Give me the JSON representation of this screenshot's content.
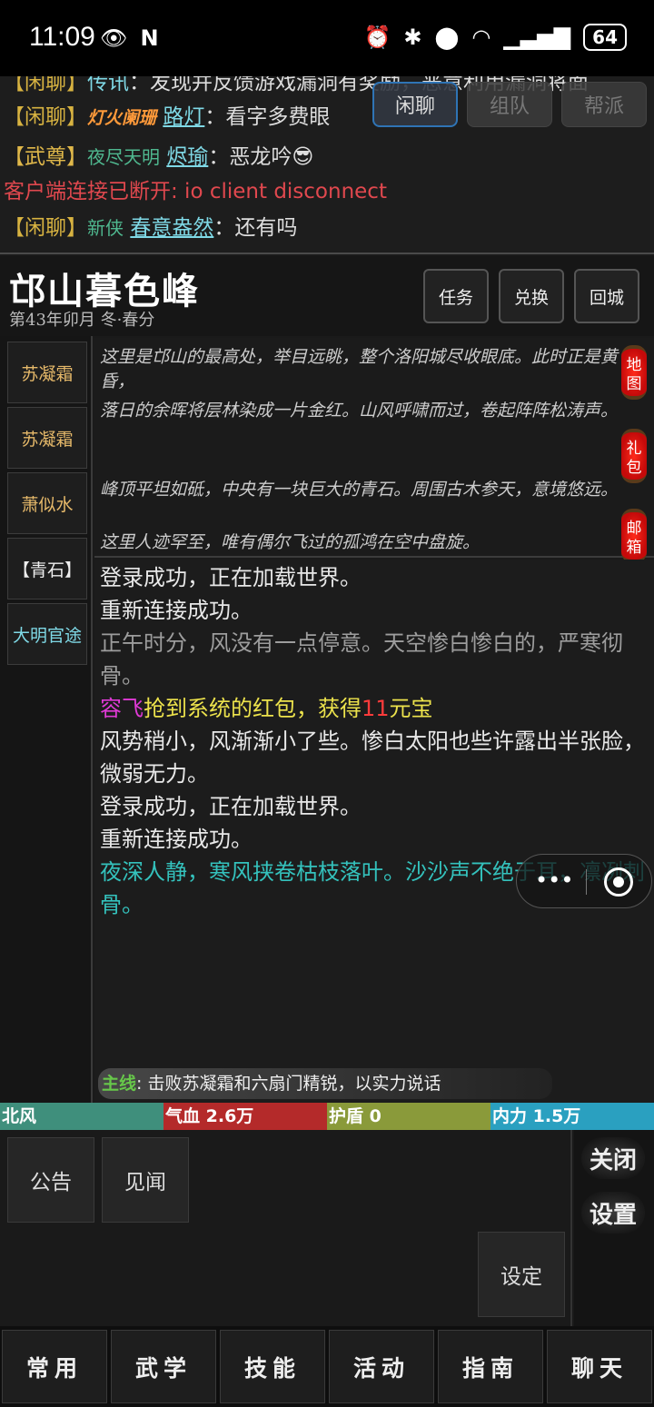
{
  "status_bar": {
    "time": "11:09",
    "battery": "64"
  },
  "chat": {
    "tabs": [
      "闲聊",
      "组队",
      "帮派"
    ],
    "lines": [
      {
        "tag": "【闲聊】",
        "speaker": "传讯",
        "text": "：发现并反馈游戏漏洞有奖励，恶意利用漏洞将面"
      },
      {
        "tag": "【闲聊】",
        "title": "灯火阑珊",
        "speaker": "路灯",
        "text": "：看字多费眼"
      },
      {
        "tag": "【武尊】",
        "title": "夜尽天明",
        "speaker": "烬瑜",
        "text": "：恶龙吟😎"
      },
      {
        "system": "客户端连接已断开: io client disconnect"
      },
      {
        "tag": "【闲聊】",
        "title": "新侠",
        "speaker": "春意盎然",
        "text": "：还有吗"
      }
    ]
  },
  "location": {
    "name": "邙山暮色峰",
    "date": "第43年卯月 冬·春分",
    "buttons": [
      "任务",
      "兑换",
      "回城"
    ]
  },
  "npcs": [
    "苏凝霜",
    "苏凝霜",
    "萧似水",
    "【青石】",
    "大明官途"
  ],
  "description": [
    "这里是邙山的最高处，举目远眺，整个洛阳城尽收眼底。此时正是黄昏，",
    "落日的余晖将层林染成一片金红。山风呼啸而过，卷起阵阵松涛声。",
    "峰顶平坦如砥，中央有一块巨大的青石。周围古木参天，意境悠远。",
    "这里人迹罕至，唯有偶尔飞过的孤鸿在空中盘旋。"
  ],
  "lanterns": [
    "地图",
    "礼包",
    "邮箱"
  ],
  "log": {
    "l1": "登录成功，正在加载世界。",
    "l2": "重新连接成功。",
    "l3": "正午时分，风没有一点停意。天空惨白惨白的，严寒彻骨。",
    "l4_name": "容飞",
    "l4_mid": "抢到系统的红包，获得",
    "l4_num": "11",
    "l4_unit": "元宝",
    "l5": "风势稍小，风渐渐小了些。惨白太阳也些许露出半张脸，微弱无力。",
    "l6": "登录成功，正在加载世界。",
    "l7": "重新连接成功。",
    "l8": "夜深人静，寒风挟卷枯枝落叶。沙沙声不绝于耳，凛冽刺骨。"
  },
  "quest": {
    "tag": "主线",
    "text": ": 击败苏凝霜和六扇门精锐，以实力说话"
  },
  "stats": [
    {
      "label": "北风",
      "value": "",
      "color": "#3f8f7c"
    },
    {
      "label": "气血",
      "value": "2.6万",
      "color": "#b42a2a"
    },
    {
      "label": "护盾",
      "value": "0",
      "color": "#8a9a3a"
    },
    {
      "label": "内力",
      "value": "1.5万",
      "color": "#2aa0c0"
    }
  ],
  "actions": {
    "notice": "公告",
    "news": "见闻",
    "setting": "设定"
  },
  "side": {
    "close": "关闭",
    "settings": "设置"
  },
  "nav": [
    "常用",
    "武学",
    "技能",
    "活动",
    "指南",
    "聊天"
  ]
}
